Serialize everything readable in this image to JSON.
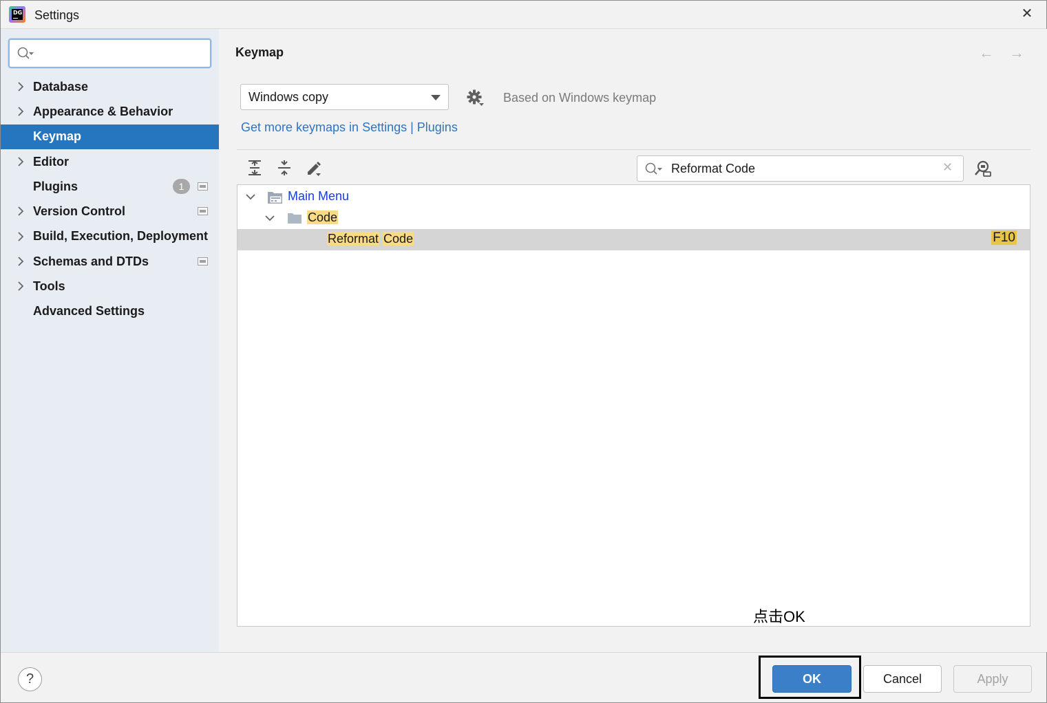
{
  "window": {
    "title": "Settings"
  },
  "app_icon": {
    "letters": "DG"
  },
  "sidebar": {
    "search": {
      "placeholder": "",
      "value": ""
    },
    "items": [
      {
        "label": "Database",
        "expandable": true
      },
      {
        "label": "Appearance & Behavior",
        "expandable": true
      },
      {
        "label": "Keymap",
        "expandable": false,
        "selected": true
      },
      {
        "label": "Editor",
        "expandable": true
      },
      {
        "label": "Plugins",
        "expandable": false,
        "badge": "1",
        "project_icon": true
      },
      {
        "label": "Version Control",
        "expandable": true,
        "project_icon": true
      },
      {
        "label": "Build, Execution, Deployment",
        "expandable": true
      },
      {
        "label": "Schemas and DTDs",
        "expandable": true,
        "project_icon": true
      },
      {
        "label": "Tools",
        "expandable": true
      },
      {
        "label": "Advanced Settings",
        "expandable": false
      }
    ]
  },
  "main": {
    "title": "Keymap",
    "keymap_select": {
      "value": "Windows copy"
    },
    "based_on": "Based on Windows keymap",
    "more_keymaps_link": "Get more keymaps in Settings | Plugins",
    "search": {
      "value": "Reformat Code"
    },
    "tree": {
      "rows": [
        {
          "label": "Main Menu"
        },
        {
          "label": "Code"
        },
        {
          "label_part1": "Reformat",
          "label_sep": " ",
          "label_part2": "Code",
          "shortcut": "F10"
        }
      ]
    },
    "annotation": "点击OK"
  },
  "footer": {
    "help_label": "?",
    "ok_label": "OK",
    "cancel_label": "Cancel",
    "apply_label": "Apply"
  },
  "colors": {
    "selection": "#2675bf",
    "link": "#2d74c4",
    "ok_button": "#3c7fc9",
    "search_highlight": "#f9da85"
  }
}
